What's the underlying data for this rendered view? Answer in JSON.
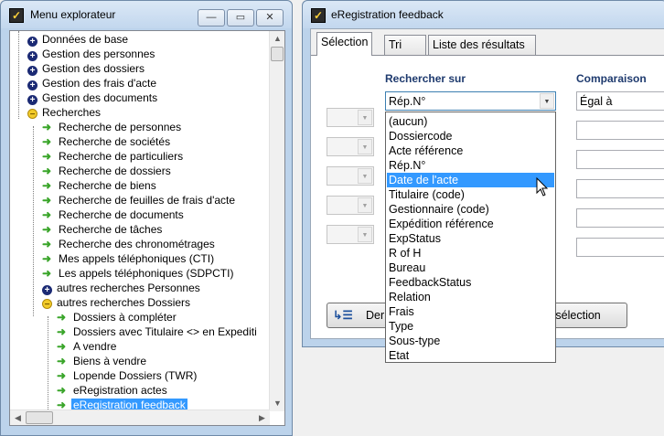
{
  "explorer": {
    "title": "Menu explorateur",
    "caption_minimize": "—",
    "caption_maximize": "▭",
    "caption_close": "✕",
    "tree": [
      {
        "label": "Données de base",
        "icon": "plus"
      },
      {
        "label": "Gestion des personnes",
        "icon": "plus"
      },
      {
        "label": "Gestion des dossiers",
        "icon": "plus"
      },
      {
        "label": "Gestion des frais d'acte",
        "icon": "plus"
      },
      {
        "label": "Gestion des documents",
        "icon": "plus"
      },
      {
        "label": "Recherches",
        "icon": "minus"
      },
      {
        "label": "Recherche de personnes",
        "icon": "arrow"
      },
      {
        "label": "Recherche de sociétés",
        "icon": "arrow"
      },
      {
        "label": "Recherche de particuliers",
        "icon": "arrow"
      },
      {
        "label": "Recherche de dossiers",
        "icon": "arrow"
      },
      {
        "label": "Recherche de biens",
        "icon": "arrow"
      },
      {
        "label": "Recherche de feuilles de frais d'acte",
        "icon": "arrow"
      },
      {
        "label": "Recherche de documents",
        "icon": "arrow"
      },
      {
        "label": "Recherche de tâches",
        "icon": "arrow"
      },
      {
        "label": "Recherche des chronométrages",
        "icon": "arrow"
      },
      {
        "label": "Mes appels téléphoniques (CTI)",
        "icon": "arrow"
      },
      {
        "label": "Les appels téléphoniques (SDPCTI)",
        "icon": "arrow"
      },
      {
        "label": "autres recherches Personnes",
        "icon": "plus"
      },
      {
        "label": "autres recherches Dossiers",
        "icon": "minus"
      },
      {
        "label": "Dossiers à compléter",
        "icon": "arrow"
      },
      {
        "label": "Dossiers avec Titulaire <> en Expediti",
        "icon": "arrow"
      },
      {
        "label": "A vendre",
        "icon": "arrow"
      },
      {
        "label": "Biens à vendre",
        "icon": "arrow"
      },
      {
        "label": "Lopende Dossiers (TWR)",
        "icon": "arrow"
      },
      {
        "label": "eRegistration actes",
        "icon": "arrow"
      },
      {
        "label": "eRegistration feedback",
        "icon": "arrow",
        "selected": true
      }
    ]
  },
  "feedback": {
    "title": "eRegistration feedback",
    "tabs": [
      "Sélection",
      "Tri",
      "Liste des résultats"
    ],
    "active_tab": "Sélection",
    "col_rechercher": "Rechercher sur",
    "col_comparaison": "Comparaison",
    "search_field_value": "Rép.N°",
    "comparison_value": "Égal à",
    "dropdown_options": [
      "(aucun)",
      "Dossiercode",
      "Acte référence",
      "Rép.N°",
      "Date de l'acte",
      "Titulaire (code)",
      "Gestionnaire (code)",
      "Expédition référence",
      "ExpStatus",
      "R of H",
      "Bureau",
      "FeedbackStatus",
      "Relation",
      "Frais",
      "Type",
      "Sous-type",
      "Etat"
    ],
    "highlighted_option": "Date de l'acte",
    "button_left_label": "Der",
    "button_right_label": "e sélection",
    "colors": {
      "highlight": "#3399ff",
      "header_text": "#1e3a6e"
    }
  }
}
